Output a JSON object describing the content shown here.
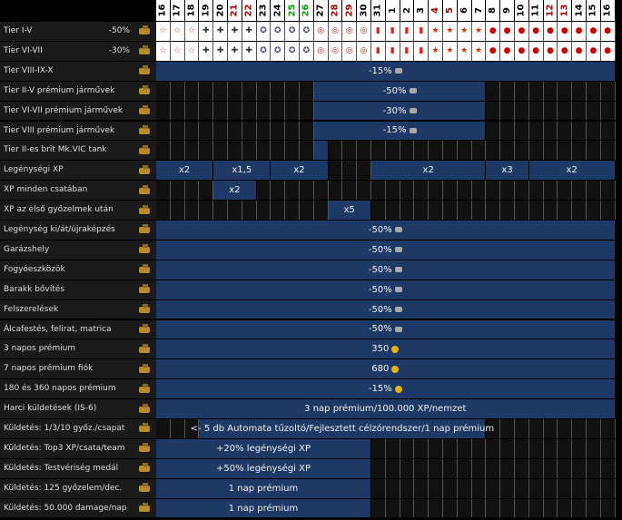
{
  "days": [
    "16",
    "17",
    "18",
    "19",
    "20",
    "21",
    "22",
    "23",
    "24",
    "25",
    "26",
    "27",
    "28",
    "29",
    "30",
    "31",
    "1",
    "2",
    "3",
    "4",
    "5",
    "6",
    "7",
    "8",
    "9",
    "10",
    "11",
    "12",
    "13",
    "14",
    "15",
    "16"
  ],
  "day_colors": [
    "#000",
    "#000",
    "#000",
    "#000",
    "#000",
    "#a00",
    "#a00",
    "#000",
    "#000",
    "#0a0",
    "#0a0",
    "#000",
    "#a00",
    "#a00",
    "#000",
    "#000",
    "#000",
    "#000",
    "#000",
    "#a00",
    "#a00",
    "#000",
    "#000",
    "#000",
    "#000",
    "#000",
    "#000",
    "#a00",
    "#a00",
    "#000",
    "#000",
    "#000"
  ],
  "tier_rows": [
    {
      "label": "Tier I-V",
      "value": "-50%",
      "icon": "tank-icon",
      "marks": [
        "☆",
        "☆",
        "☆",
        "✚",
        "✚",
        "✚",
        "✚",
        "✪",
        "✪",
        "✪",
        "✪",
        "◎",
        "◎",
        "◎",
        "◎",
        "▮",
        "▮",
        "▮",
        "▮",
        "★",
        "★",
        "★",
        "★",
        "●",
        "●",
        "●",
        "●",
        "●",
        "●",
        "●",
        "●",
        "●"
      ]
    },
    {
      "label": "Tier VI-VII",
      "value": "-30%",
      "icon": "tank-icon",
      "marks": [
        "☆",
        "☆",
        "☆",
        "✚",
        "✚",
        "✚",
        "✚",
        "✪",
        "✪",
        "✪",
        "✪",
        "◎",
        "◎",
        "◎",
        "◎",
        "▮",
        "▮",
        "▮",
        "▮",
        "★",
        "★",
        "★",
        "★",
        "●",
        "●",
        "●",
        "●",
        "●",
        "●",
        "●",
        "●",
        "●"
      ]
    }
  ],
  "mark_colors": [
    "#c33",
    "#c33",
    "#c33",
    "#333",
    "#333",
    "#333",
    "#333",
    "#446",
    "#446",
    "#446",
    "#446",
    "#a11",
    "#a11",
    "#a11",
    "#a11",
    "#d22",
    "#d22",
    "#d22",
    "#d22",
    "#c30",
    "#c30",
    "#c30",
    "#c30",
    "#c00",
    "#c00",
    "#c00",
    "#c00",
    "#c00",
    "#c00",
    "#c00",
    "#c00",
    "#c00"
  ],
  "rows": [
    {
      "label": "Tier VIII-IX-X",
      "icon": "tank-icon",
      "bars": [
        {
          "s": 0,
          "e": 32,
          "text": "-15%",
          "unit": "credit"
        }
      ]
    },
    {
      "label": "Tier II-V prémium járművek",
      "icon": "premium-tank-icon",
      "bars": [
        {
          "s": 11,
          "e": 23,
          "text": "-50%",
          "unit": "credit"
        }
      ]
    },
    {
      "label": "Tier VI-VII prémium járművek",
      "icon": "premium-tank-icon",
      "bars": [
        {
          "s": 11,
          "e": 23,
          "text": "-30%",
          "unit": "credit"
        }
      ]
    },
    {
      "label": "Tier VIII prémium járművek",
      "icon": "premium-tank-icon",
      "bars": [
        {
          "s": 11,
          "e": 23,
          "text": "-15%",
          "unit": "credit"
        }
      ]
    },
    {
      "label": "Tier II-es brit Mk.VIC tank",
      "icon": "shield-icon",
      "bars": [
        {
          "s": 11,
          "e": 12,
          "text": "",
          "unit": ""
        }
      ]
    },
    {
      "label": "Legénységi XP",
      "icon": "helmet-icon",
      "bars": [
        {
          "s": 0,
          "e": 4,
          "text": "x2",
          "unit": ""
        },
        {
          "s": 4,
          "e": 8,
          "text": "x1,5",
          "unit": ""
        },
        {
          "s": 8,
          "e": 12,
          "text": "x2",
          "unit": ""
        },
        {
          "s": 15,
          "e": 23,
          "text": "x2",
          "unit": ""
        },
        {
          "s": 23,
          "e": 26,
          "text": "x3",
          "unit": ""
        },
        {
          "s": 26,
          "e": 32,
          "text": "x2",
          "unit": ""
        }
      ]
    },
    {
      "label": "XP minden csatában",
      "icon": "x2-icon",
      "bars": [
        {
          "s": 4,
          "e": 7,
          "text": "x2",
          "unit": ""
        }
      ]
    },
    {
      "label": "XP az első győzelmek után",
      "icon": "x5-icon",
      "bars": [
        {
          "s": 12,
          "e": 15,
          "text": "x5",
          "unit": ""
        }
      ]
    },
    {
      "label": "Legénység ki/át/újraképzés",
      "icon": "crew-icon",
      "bars": [
        {
          "s": 0,
          "e": 32,
          "text": "-50%",
          "unit": "credit"
        }
      ]
    },
    {
      "label": "Garázshely",
      "icon": "garage-icon",
      "bars": [
        {
          "s": 0,
          "e": 32,
          "text": "-50%",
          "unit": "credit"
        }
      ]
    },
    {
      "label": "Fogyóeszközök",
      "icon": "consumables-icon",
      "bars": [
        {
          "s": 0,
          "e": 32,
          "text": "-50%",
          "unit": "credit"
        }
      ]
    },
    {
      "label": "Barakk bővítés",
      "icon": "barracks-icon",
      "bars": [
        {
          "s": 0,
          "e": 32,
          "text": "-50%",
          "unit": "credit"
        }
      ]
    },
    {
      "label": "Felszerelések",
      "icon": "gear-icon",
      "bars": [
        {
          "s": 0,
          "e": 32,
          "text": "-50%",
          "unit": "credit"
        }
      ]
    },
    {
      "label": "Álcafestés, felirat, matrica",
      "icon": "camo-icon",
      "bars": [
        {
          "s": 0,
          "e": 32,
          "text": "-50%",
          "unit": "credit"
        }
      ]
    },
    {
      "label": "3 napos prémium",
      "icon": "premium-badge-icon",
      "bars": [
        {
          "s": 0,
          "e": 32,
          "text": "350",
          "unit": "gold"
        }
      ]
    },
    {
      "label": "7 napos prémium fiók",
      "icon": "premium-badge-icon",
      "bars": [
        {
          "s": 0,
          "e": 32,
          "text": "680",
          "unit": "gold"
        }
      ]
    },
    {
      "label": "180 és 360 napos prémium",
      "icon": "premium-badge-icon",
      "bars": [
        {
          "s": 0,
          "e": 32,
          "text": "-15%",
          "unit": "gold"
        }
      ]
    },
    {
      "label": "Harci küldetések (IS-6)",
      "icon": "crossed-swords-icon",
      "bars": [
        {
          "s": 0,
          "e": 32,
          "text": "3 nap prémium/100.000 XP/nemzet",
          "unit": ""
        }
      ]
    },
    {
      "label": "Küldetés: 1/3/10 győz./csapat",
      "icon": "crossed-swords-icon",
      "bars": [
        {
          "s": 3,
          "e": 23,
          "text": "<- 5 db Automata tűzoltó/Fejlesztett célzórendszer/1 nap prémium",
          "unit": ""
        }
      ]
    },
    {
      "label": "Küldetés: Top3 XP/csata/team",
      "icon": "crossed-swords-icon",
      "bars": [
        {
          "s": 0,
          "e": 15,
          "text": "+20% legénységi XP",
          "unit": ""
        }
      ]
    },
    {
      "label": "Küldetés: Testvériség medál",
      "icon": "crossed-swords-icon",
      "bars": [
        {
          "s": 0,
          "e": 15,
          "text": "+50% legénységi XP",
          "unit": ""
        }
      ]
    },
    {
      "label": "Küldetés: 125 győzelem/dec.",
      "icon": "crossed-swords-icon",
      "bars": [
        {
          "s": 0,
          "e": 15,
          "text": "1 nap prémium",
          "unit": ""
        }
      ]
    },
    {
      "label": "Küldetés: 50.000 damage/nap",
      "icon": "crossed-swords-icon",
      "bars": [
        {
          "s": 0,
          "e": 15,
          "text": "1 nap prémium",
          "unit": ""
        }
      ]
    }
  ]
}
